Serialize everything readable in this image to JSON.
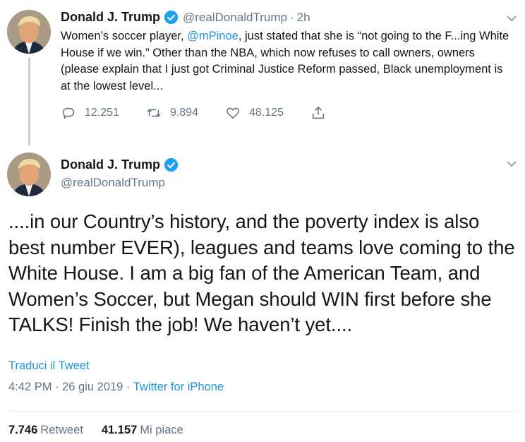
{
  "tweet1": {
    "author_name": "Donald J. Trump",
    "handle": "@realDonaldTrump",
    "separator": "·",
    "time": "2h",
    "text_before_mention": "Women’s soccer player, ",
    "mention": "@mPinoe",
    "text_after_mention": ", just stated that she is “not going to the F...ing White House if we win.” Other than the NBA, which now refuses to call owners, owners (please explain that I just got Criminal Justice Reform passed, Black unemployment is at the lowest level...",
    "replies": "12.251",
    "retweets": "9.894",
    "likes": "48.125"
  },
  "tweet2": {
    "author_name": "Donald J. Trump",
    "handle": "@realDonaldTrump",
    "text": "....in our Country’s history, and the poverty index is also best number EVER), leagues and teams love coming to the White House. I am a big fan of the American Team, and Women’s Soccer, but Megan should WIN first before she TALKS! Finish the job! We haven’t yet....",
    "translate_link": "Traduci il Tweet",
    "timestamp": "4:42 PM · 26 giu 2019 · ",
    "source": "Twitter for iPhone",
    "retweet_count": "7.746",
    "retweet_label": "Retweet",
    "like_count": "41.157",
    "like_label": "Mi piace"
  },
  "icons": {
    "verified": "verified-badge-icon",
    "caret": "chevron-down-icon",
    "reply": "reply-icon",
    "retweet": "retweet-icon",
    "like": "heart-icon",
    "share": "share-icon"
  },
  "colors": {
    "link": "#1b95e0",
    "verified": "#1da1f2",
    "muted": "#657786",
    "text": "#14171a",
    "thread_line": "#c4cfd6"
  }
}
